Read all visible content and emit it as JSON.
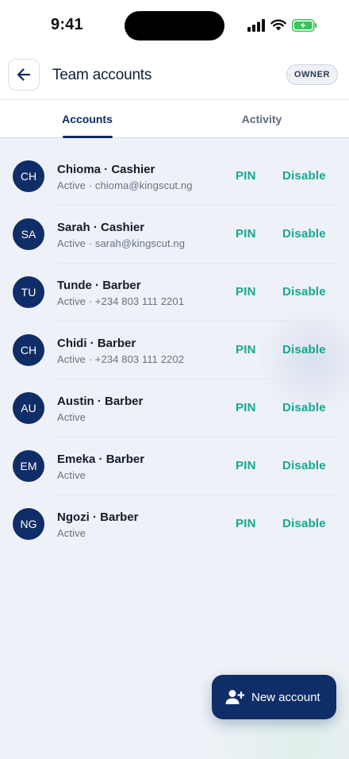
{
  "status_bar": {
    "time": "9:41"
  },
  "header": {
    "title": "Team accounts",
    "role_badge": "OWNER"
  },
  "tabs": [
    {
      "label": "Accounts",
      "active": true
    },
    {
      "label": "Activity",
      "active": false
    }
  ],
  "colors": {
    "primary": "#0f2d66",
    "accent": "#13a98f"
  },
  "accounts": [
    {
      "initials": "CH",
      "name": "Chioma · Cashier",
      "subtitle": "Active · chioma@kingscut.ng",
      "pin_label": "PIN",
      "disable_label": "Disable"
    },
    {
      "initials": "SA",
      "name": "Sarah · Cashier",
      "subtitle": "Active · sarah@kingscut.ng",
      "pin_label": "PIN",
      "disable_label": "Disable"
    },
    {
      "initials": "TU",
      "name": "Tunde · Barber",
      "subtitle": "Active · +234 803 111 2201",
      "pin_label": "PIN",
      "disable_label": "Disable"
    },
    {
      "initials": "CH",
      "name": "Chidi · Barber",
      "subtitle": "Active · +234 803 111 2202",
      "pin_label": "PIN",
      "disable_label": "Disable"
    },
    {
      "initials": "AU",
      "name": "Austin · Barber",
      "subtitle": "Active",
      "pin_label": "PIN",
      "disable_label": "Disable"
    },
    {
      "initials": "EM",
      "name": "Emeka · Barber",
      "subtitle": "Active",
      "pin_label": "PIN",
      "disable_label": "Disable"
    },
    {
      "initials": "NG",
      "name": "Ngozi · Barber",
      "subtitle": "Active",
      "pin_label": "PIN",
      "disable_label": "Disable"
    }
  ],
  "fab": {
    "label": "New account",
    "icon": "add-user-icon"
  }
}
